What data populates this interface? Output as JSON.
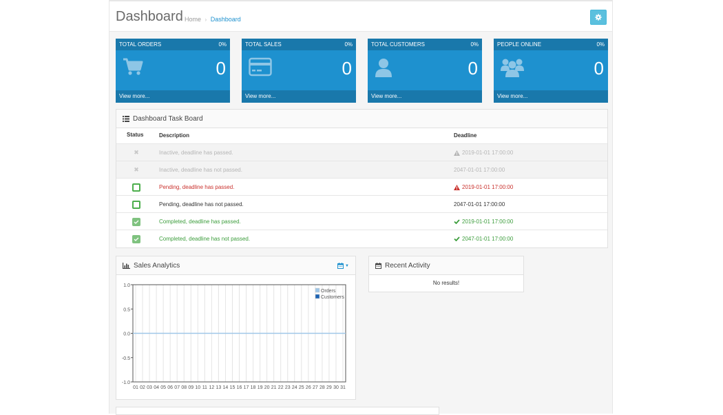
{
  "header": {
    "title": "Dashboard",
    "breadcrumb": [
      "Home",
      "Dashboard"
    ],
    "settings_icon": "gear-icon"
  },
  "tiles": [
    {
      "label": "TOTAL ORDERS",
      "percent": "0%",
      "value": "0",
      "link": "View more...",
      "icon": "shopping-cart-icon"
    },
    {
      "label": "TOTAL SALES",
      "percent": "0%",
      "value": "0",
      "link": "View more...",
      "icon": "credit-card-icon"
    },
    {
      "label": "TOTAL CUSTOMERS",
      "percent": "0%",
      "value": "0",
      "link": "View more...",
      "icon": "user-icon"
    },
    {
      "label": "PEOPLE ONLINE",
      "percent": "0%",
      "value": "0",
      "link": "View more...",
      "icon": "users-icon"
    }
  ],
  "taskboard": {
    "title": "Dashboard Task Board",
    "columns": [
      "Status",
      "Description",
      "Deadline"
    ],
    "rows": [
      {
        "status": "inactive",
        "description": "Inactive, deadline has passed.",
        "deadline": "2019-01-01 17:00:00",
        "deadline_icon": "warning-icon"
      },
      {
        "status": "inactive",
        "description": "Inactive, deadline has not passed.",
        "deadline": "2047-01-01 17:00:00",
        "deadline_icon": ""
      },
      {
        "status": "pending",
        "description": "Pending, deadline has passed.",
        "deadline": "2019-01-01 17:00:00",
        "deadline_icon": "warning-icon"
      },
      {
        "status": "pending",
        "description": "Pending, deadline has not passed.",
        "deadline": "2047-01-01 17:00:00",
        "deadline_icon": ""
      },
      {
        "status": "completed",
        "description": "Completed, deadline has passed.",
        "deadline": "2019-01-01 17:00:00",
        "deadline_icon": "check-icon"
      },
      {
        "status": "completed",
        "description": "Completed, deadline has not passed.",
        "deadline": "2047-01-01 17:00:00",
        "deadline_icon": "check-icon"
      }
    ]
  },
  "sales": {
    "title": "Sales Analytics",
    "range_icon": "calendar-icon"
  },
  "activity": {
    "title": "Recent Activity",
    "empty_text": "No results!"
  },
  "colors": {
    "tile_bg": "#1e91cf",
    "tile_bar": "#1978ab",
    "pending": "#c9302c",
    "completed": "#3c9d3c"
  },
  "chart_data": {
    "type": "line",
    "title": "",
    "xlabel": "",
    "ylabel": "",
    "categories": [
      "01",
      "02",
      "03",
      "04",
      "05",
      "06",
      "07",
      "08",
      "09",
      "10",
      "11",
      "12",
      "13",
      "14",
      "15",
      "16",
      "17",
      "18",
      "19",
      "20",
      "21",
      "22",
      "23",
      "24",
      "25",
      "26",
      "27",
      "28",
      "29",
      "30",
      "31"
    ],
    "y_ticks": [
      "1.0",
      "0.5",
      "0.0",
      "-0.5",
      "-1.0"
    ],
    "ylim": [
      -1,
      1
    ],
    "series": [
      {
        "name": "Orders",
        "color": "#9fc7e8",
        "values": []
      },
      {
        "name": "Customers",
        "color": "#1e64b4",
        "values": []
      }
    ],
    "legend_position": "top-right",
    "grid": true
  }
}
